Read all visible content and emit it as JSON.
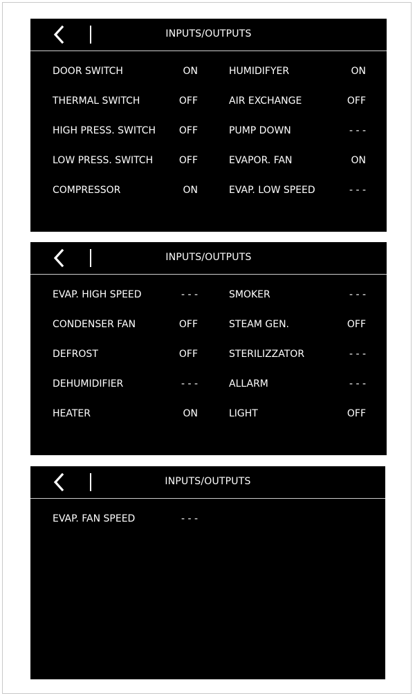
{
  "screens": [
    {
      "title": "INPUTS/OUTPUTS",
      "rows": [
        {
          "left_label": "DOOR SWITCH",
          "left_value": "ON",
          "right_label": "HUMIDIFYER",
          "right_value": "ON"
        },
        {
          "left_label": "THERMAL SWITCH",
          "left_value": "OFF",
          "right_label": "AIR EXCHANGE",
          "right_value": "OFF"
        },
        {
          "left_label": "HIGH PRESS. SWITCH",
          "left_value": "OFF",
          "right_label": "PUMP DOWN",
          "right_value": "- - -"
        },
        {
          "left_label": "LOW PRESS. SWITCH",
          "left_value": "OFF",
          "right_label": "EVAPOR. FAN",
          "right_value": "ON"
        },
        {
          "left_label": "COMPRESSOR",
          "left_value": "ON",
          "right_label": "EVAP. LOW SPEED",
          "right_value": "- - -"
        }
      ]
    },
    {
      "title": "INPUTS/OUTPUTS",
      "rows": [
        {
          "left_label": "EVAP. HIGH SPEED",
          "left_value": "- - -",
          "right_label": "SMOKER",
          "right_value": "- - -"
        },
        {
          "left_label": "CONDENSER FAN",
          "left_value": "OFF",
          "right_label": "STEAM GEN.",
          "right_value": "OFF"
        },
        {
          "left_label": "DEFROST",
          "left_value": "OFF",
          "right_label": "STERILIZZATOR",
          "right_value": "- - -"
        },
        {
          "left_label": "DEHUMIDIFIER",
          "left_value": "- - -",
          "right_label": "ALLARM",
          "right_value": "- - -"
        },
        {
          "left_label": "HEATER",
          "left_value": "ON",
          "right_label": "LIGHT",
          "right_value": "OFF"
        }
      ]
    },
    {
      "title": "INPUTS/OUTPUTS",
      "rows": [
        {
          "left_label": "EVAP. FAN SPEED",
          "left_value": "- - -"
        }
      ]
    }
  ],
  "icons": {
    "back": "chevron-left-icon"
  },
  "colors": {
    "screen_background": "#000000",
    "text": "#ffffff",
    "header_rule": "#cfcfcf",
    "frame_border": "#c8c8c8"
  }
}
